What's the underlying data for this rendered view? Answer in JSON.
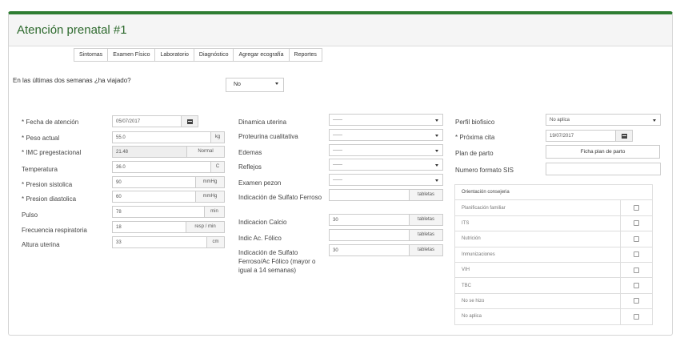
{
  "title": "Atención prenatal #1",
  "tabs": [
    "Sintomas",
    "Examen Físico",
    "Laboratorio",
    "Diagnóstico",
    "Agregar ecografía",
    "Reportes"
  ],
  "travel": {
    "question": "En las últimas dos semanas ¿ha viajado?",
    "value": "No"
  },
  "left": {
    "fecha_atencion": {
      "label": "* Fecha de atención",
      "value": "05/07/2017"
    },
    "peso": {
      "label": "* Peso actual",
      "value": "55.0",
      "unit": "kg"
    },
    "imc": {
      "label": "* IMC pregestacional",
      "value": "21.48",
      "unit": "Normal"
    },
    "temperatura": {
      "label": "Temperatura",
      "value": "36.0",
      "unit": "C"
    },
    "sistolica": {
      "label": "* Presion sistolica",
      "value": "90",
      "unit": "mmHg"
    },
    "diastolica": {
      "label": "* Presion diastolica",
      "value": "60",
      "unit": "mmHg"
    },
    "pulso": {
      "label": "Pulso",
      "value": "78",
      "unit": "min"
    },
    "frecuencia": {
      "label": "Frecuencia respiratoria",
      "value": "18",
      "unit": "resp / min"
    },
    "altura": {
      "label": "Altura uterina",
      "value": "33",
      "unit": "cm"
    }
  },
  "middle": {
    "dinamica": {
      "label": "Dinamica uterina",
      "value": "------"
    },
    "proteinuria": {
      "label": "Proteurina cualitativa",
      "value": "------"
    },
    "edemas": {
      "label": "Edemas",
      "value": "------"
    },
    "reflejos": {
      "label": "Reflejos",
      "value": "------"
    },
    "pezon": {
      "label": "Examen pezon",
      "value": "------"
    },
    "sulfato": {
      "label": "Indicación de Sulfato Ferroso",
      "value": "",
      "unit": "tabletas"
    },
    "calcio": {
      "label": "Indicacion Calcio",
      "value": "30",
      "unit": "tabletas"
    },
    "folico": {
      "label": "Indic Ac. Fólico",
      "value": "",
      "unit": "tabletas"
    },
    "sulfato_folico": {
      "label": "Indicación de Sulfato Ferroso/Ac Fólico (mayor o igual a 14 semanas)",
      "value": "30",
      "unit": "tabletas"
    }
  },
  "right": {
    "perfil": {
      "label": "Perfil biofisico",
      "value": "No aplica"
    },
    "proxima": {
      "label": "* Próxima cita",
      "value": "19/07/2017"
    },
    "plan": {
      "label": "Plan de parto",
      "button": "Ficha plan de parto"
    },
    "sis": {
      "label": "Numero formato SIS",
      "value": ""
    },
    "orientacion": {
      "header": "Orientación consejeria",
      "items": [
        "Planificación familiar",
        "ITS",
        "Nutrición",
        "Inmunizaciones",
        "VIH",
        "TBC",
        "No se hizo",
        "No aplica"
      ]
    }
  }
}
